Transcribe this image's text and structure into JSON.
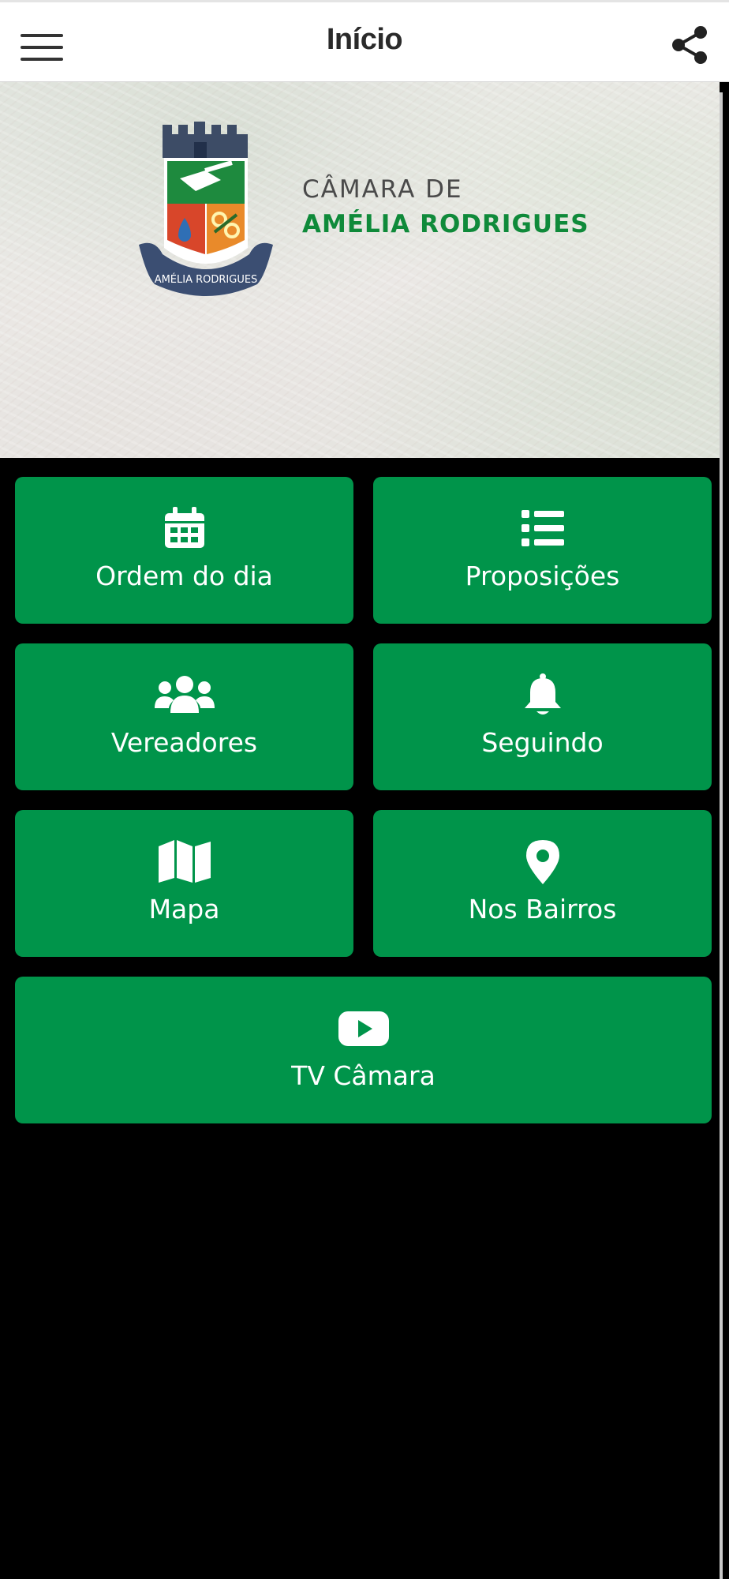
{
  "header": {
    "title": "Início"
  },
  "hero": {
    "line1": "CÂMARA DE",
    "line2": "AMÉLIA RODRIGUES",
    "crest_caption": "AMÉLIA RODRIGUES"
  },
  "tiles": [
    {
      "label": "Ordem do dia",
      "icon": "calendar-icon"
    },
    {
      "label": "Proposições",
      "icon": "list-icon"
    },
    {
      "label": "Vereadores",
      "icon": "users-icon"
    },
    {
      "label": "Seguindo",
      "icon": "bell-icon"
    },
    {
      "label": "Mapa",
      "icon": "map-icon"
    },
    {
      "label": "Nos Bairros",
      "icon": "map-pin-icon"
    },
    {
      "label": "TV Câmara",
      "icon": "youtube-icon"
    }
  ],
  "colors": {
    "accent": "#00944a",
    "background": "#000000",
    "topbar": "#ffffff"
  }
}
